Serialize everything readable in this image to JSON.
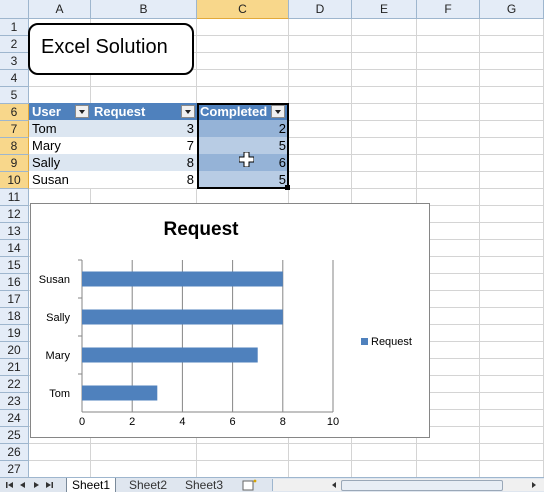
{
  "columns": [
    "A",
    "B",
    "C",
    "D",
    "E",
    "F",
    "G"
  ],
  "selected_column": "C",
  "rows": [
    "1",
    "2",
    "3",
    "4",
    "5",
    "6",
    "7",
    "8",
    "9",
    "10",
    "11",
    "12",
    "13",
    "14",
    "15",
    "16",
    "17",
    "18",
    "19",
    "20",
    "21",
    "22",
    "23",
    "24",
    "25",
    "26",
    "27"
  ],
  "selected_rows": [
    "6",
    "7",
    "8",
    "9",
    "10"
  ],
  "title_box": "Excel Solution",
  "table": {
    "headers": [
      "User",
      "Request",
      "Completed"
    ],
    "rows": [
      {
        "user": "Tom",
        "request": "3",
        "completed": "2"
      },
      {
        "user": "Mary",
        "request": "7",
        "completed": "5"
      },
      {
        "user": "Sally",
        "request": "8",
        "completed": "6"
      },
      {
        "user": "Susan",
        "request": "8",
        "completed": "5"
      }
    ]
  },
  "chart_data": {
    "type": "bar",
    "orientation": "horizontal",
    "title": "Request",
    "categories": [
      "Tom",
      "Mary",
      "Sally",
      "Susan"
    ],
    "series": [
      {
        "name": "Request",
        "values": [
          3,
          7,
          8,
          8
        ]
      }
    ],
    "xlim": [
      0,
      10
    ],
    "ticks": [
      "0",
      "2",
      "4",
      "6",
      "8",
      "10"
    ],
    "grid": true,
    "legend": "right",
    "color": "#4f81bd"
  },
  "sheet_tabs": [
    "Sheet1",
    "Sheet2",
    "Sheet3"
  ],
  "active_sheet": "Sheet1",
  "colors": {
    "header_blue": "#4f81bd",
    "band": "#dce6f1",
    "selected_header": "#f8d78b"
  }
}
